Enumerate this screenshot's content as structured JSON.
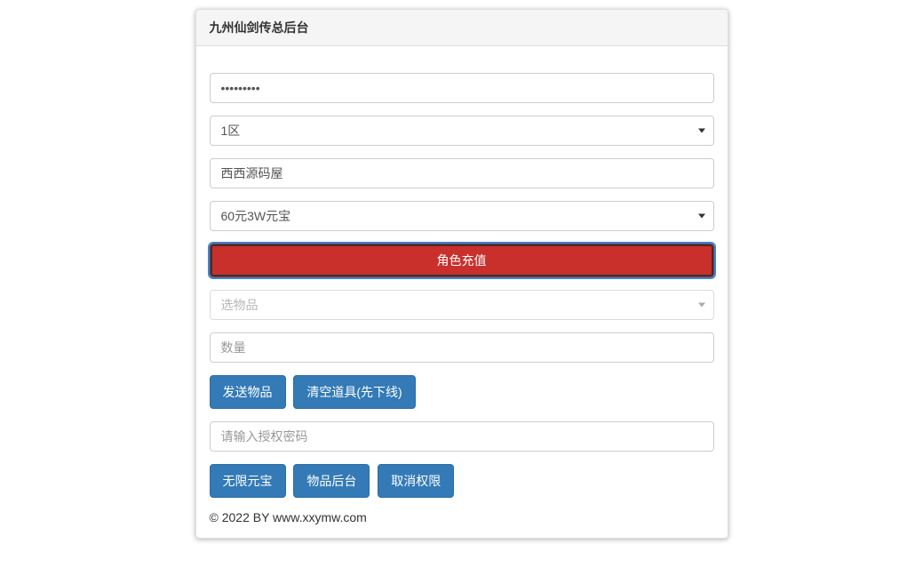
{
  "panel": {
    "title": "九州仙剑传总后台"
  },
  "form": {
    "password_value": "••••••••",
    "zone_selected": "1区",
    "role_name": "西西源码屋",
    "recharge_selected": "60元3W元宝",
    "recharge_button": "角色充值",
    "item_select_placeholder": "选物品",
    "quantity_placeholder": "数量",
    "send_item_button": "发送物品",
    "clear_items_button": "清空道具(先下线)",
    "auth_password_placeholder": "请输入授权密码",
    "unlimited_gold_button": "无限元宝",
    "item_backend_button": "物品后台",
    "cancel_permission_button": "取消权限"
  },
  "footer": {
    "copyright": "© 2022 BY www.xxymw.com"
  }
}
